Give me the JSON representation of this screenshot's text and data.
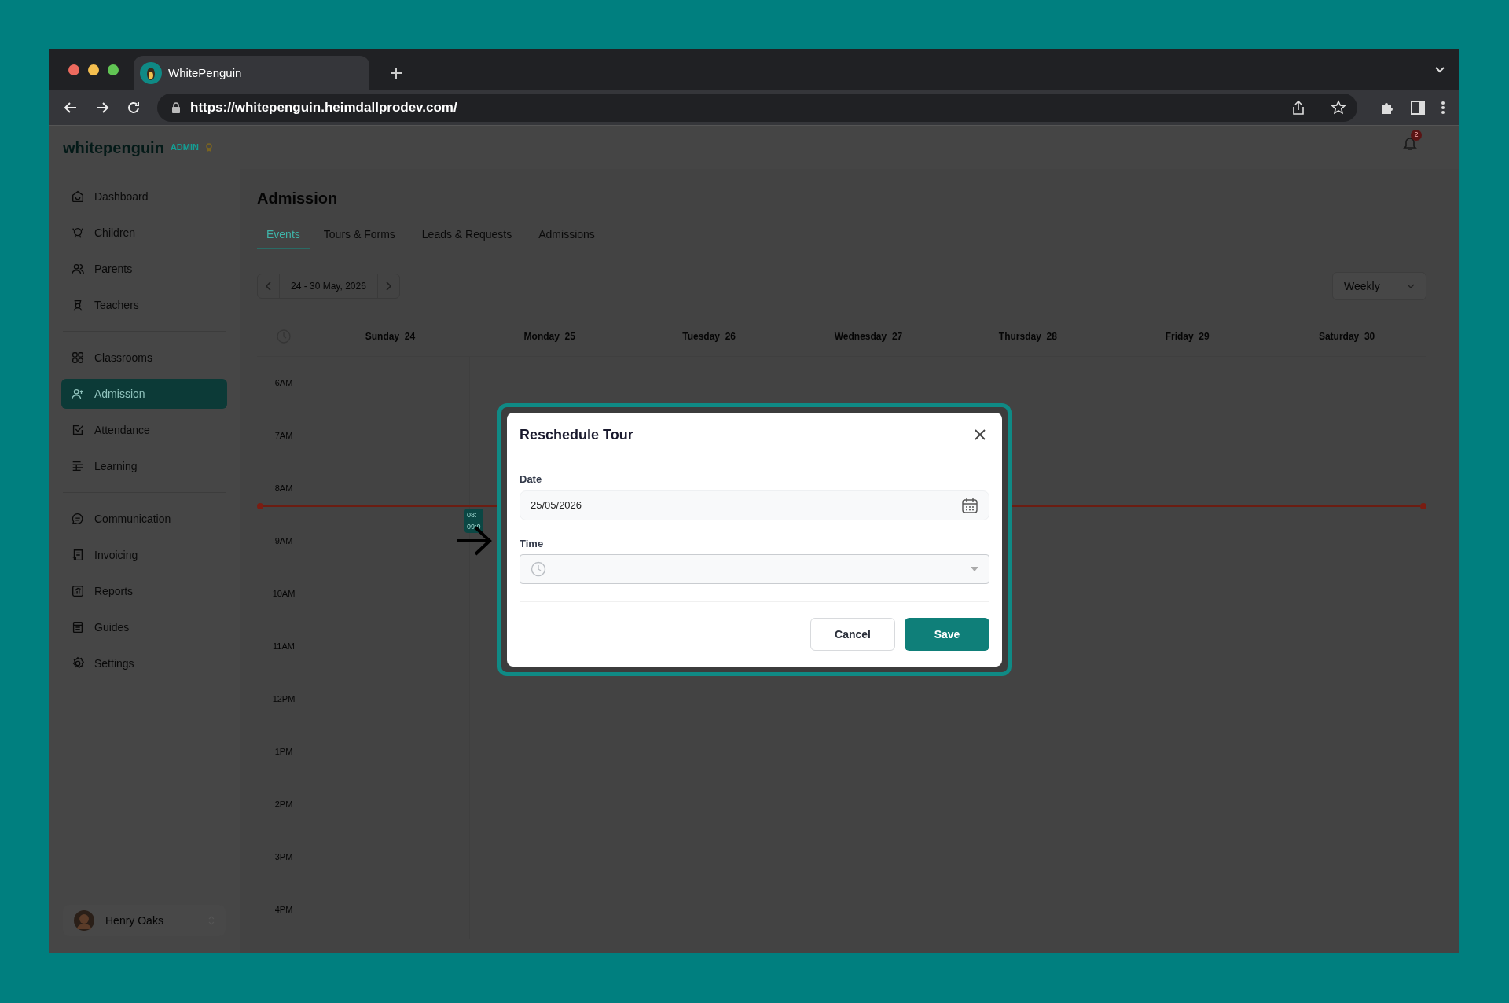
{
  "browser": {
    "tab_title": "WhitePenguin",
    "url": "https://whitepenguin.heimdallprodev.com/"
  },
  "sidebar": {
    "logo": "whitepenguin",
    "role_badge": "ADMIN",
    "sections": [
      {
        "items": [
          {
            "label": "Dashboard",
            "selected": false
          },
          {
            "label": "Children",
            "selected": false
          },
          {
            "label": "Parents",
            "selected": false
          },
          {
            "label": "Teachers",
            "selected": false
          }
        ]
      },
      {
        "items": [
          {
            "label": "Classrooms",
            "selected": false
          },
          {
            "label": "Admission",
            "selected": true
          },
          {
            "label": "Attendance",
            "selected": false
          },
          {
            "label": "Learning",
            "selected": false
          }
        ]
      },
      {
        "items": [
          {
            "label": "Communication",
            "selected": false
          },
          {
            "label": "Invoicing",
            "selected": false
          },
          {
            "label": "Reports",
            "selected": false
          },
          {
            "label": "Guides",
            "selected": false
          },
          {
            "label": "Settings",
            "selected": false
          }
        ]
      }
    ],
    "user": {
      "name": "Henry Oaks"
    }
  },
  "header": {
    "notification_count": "2"
  },
  "page": {
    "title": "Admission",
    "tabs": [
      {
        "label": "Events",
        "selected": true
      },
      {
        "label": "Tours & Forms",
        "selected": false
      },
      {
        "label": "Leads & Requests",
        "selected": false
      },
      {
        "label": "Admissions",
        "selected": false
      }
    ],
    "date_range": "24 - 30 May, 2026",
    "view": "Weekly"
  },
  "calendar": {
    "days": [
      {
        "name": "Sunday",
        "date": "24"
      },
      {
        "name": "Monday",
        "date": "25"
      },
      {
        "name": "Tuesday",
        "date": "26"
      },
      {
        "name": "Wednesday",
        "date": "27"
      },
      {
        "name": "Thursday",
        "date": "28"
      },
      {
        "name": "Friday",
        "date": "29"
      },
      {
        "name": "Saturday",
        "date": "30"
      }
    ],
    "hours": [
      "6AM",
      "7AM",
      "8AM",
      "9AM",
      "10AM",
      "11AM",
      "12PM",
      "1PM",
      "2PM",
      "3PM",
      "4PM"
    ],
    "events": [
      {
        "lines": [
          "08:",
          "09:0"
        ]
      }
    ]
  },
  "modal": {
    "title": "Reschedule Tour",
    "fields": [
      {
        "kind": "date",
        "label": "Date",
        "value": "25/05/2026"
      },
      {
        "kind": "time",
        "label": "Time"
      }
    ],
    "buttons": [
      {
        "kind": "secondary",
        "label": "Cancel"
      },
      {
        "kind": "primary",
        "label": "Save"
      }
    ]
  }
}
